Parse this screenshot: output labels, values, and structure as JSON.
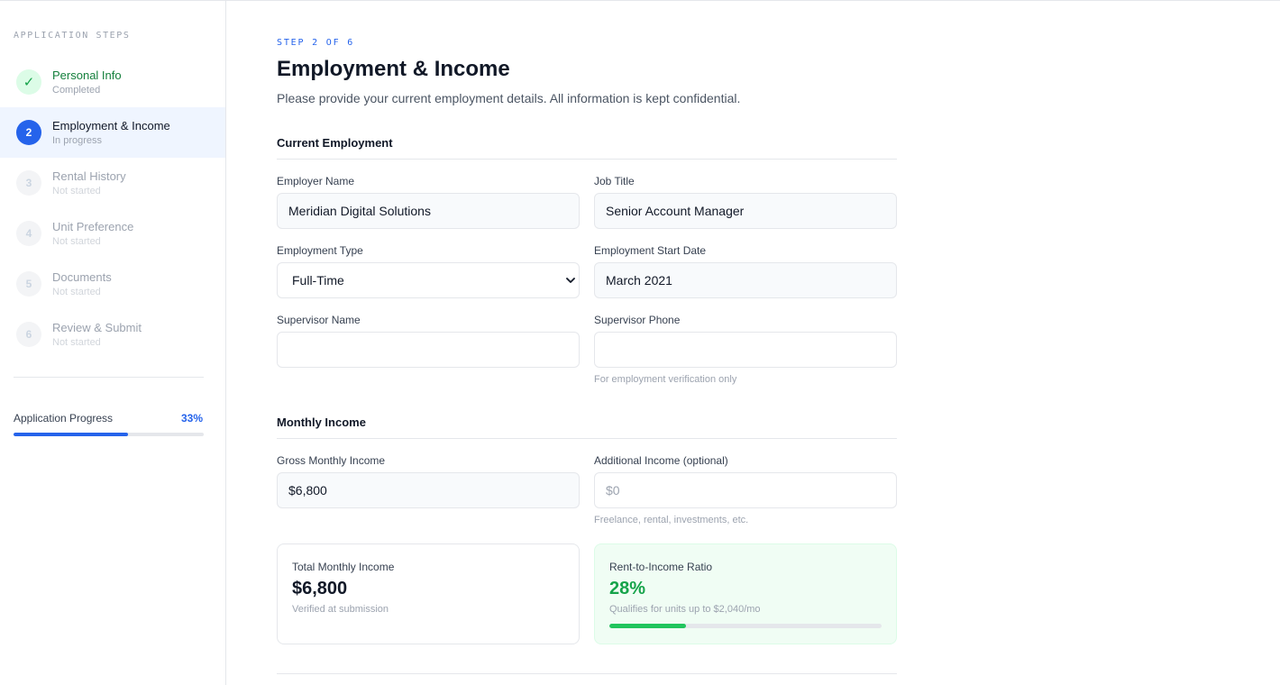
{
  "sidebar": {
    "heading": "APPLICATION STEPS",
    "steps": [
      {
        "badge": "✓",
        "label": "Personal Info",
        "status": "Completed",
        "state": "done"
      },
      {
        "badge": "2",
        "label": "Employment & Income",
        "status": "In progress",
        "state": "active"
      },
      {
        "badge": "3",
        "label": "Rental History",
        "status": "Not started",
        "state": "todo"
      },
      {
        "badge": "4",
        "label": "Unit Preference",
        "status": "Not started",
        "state": "todo"
      },
      {
        "badge": "5",
        "label": "Documents",
        "status": "Not started",
        "state": "todo"
      },
      {
        "badge": "6",
        "label": "Review & Submit",
        "status": "Not started",
        "state": "todo"
      }
    ],
    "progress": {
      "label": "Application Progress",
      "percent_text": "33%",
      "value": 0.6
    }
  },
  "main": {
    "step_counter": "STEP 2 OF 6",
    "title": "Employment & Income",
    "description": "Please provide your current employment details. All information is kept confidential.",
    "employment": {
      "section_title": "Current Employment",
      "employer_name": {
        "label": "Employer Name",
        "value": "Meridian Digital Solutions"
      },
      "job_title": {
        "label": "Job Title",
        "value": "Senior Account Manager"
      },
      "employment_type": {
        "label": "Employment Type",
        "value": "Full-Time"
      },
      "start_date": {
        "label": "Employment Start Date",
        "value": "March 2021"
      },
      "supervisor_name": {
        "label": "Supervisor Name",
        "value": ""
      },
      "supervisor_phone": {
        "label": "Supervisor Phone",
        "value": "",
        "hint": "For employment verification only"
      }
    },
    "income": {
      "section_title": "Monthly Income",
      "gross": {
        "label": "Gross Monthly Income",
        "value": "$6,800"
      },
      "additional": {
        "label": "Additional Income (optional)",
        "placeholder": "$0",
        "hint": "Freelance, rental, investments, etc."
      },
      "total_card": {
        "label": "Total Monthly Income",
        "value": "$6,800",
        "sub": "Verified at submission"
      },
      "ratio_card": {
        "label": "Rent-to-Income Ratio",
        "value": "28%",
        "sub": "Qualifies for units up to $2,040/mo",
        "fill": 0.28
      }
    }
  },
  "colors": {
    "accent": "#2563eb",
    "success": "#16a34a",
    "success_bar": "#22c55e"
  }
}
